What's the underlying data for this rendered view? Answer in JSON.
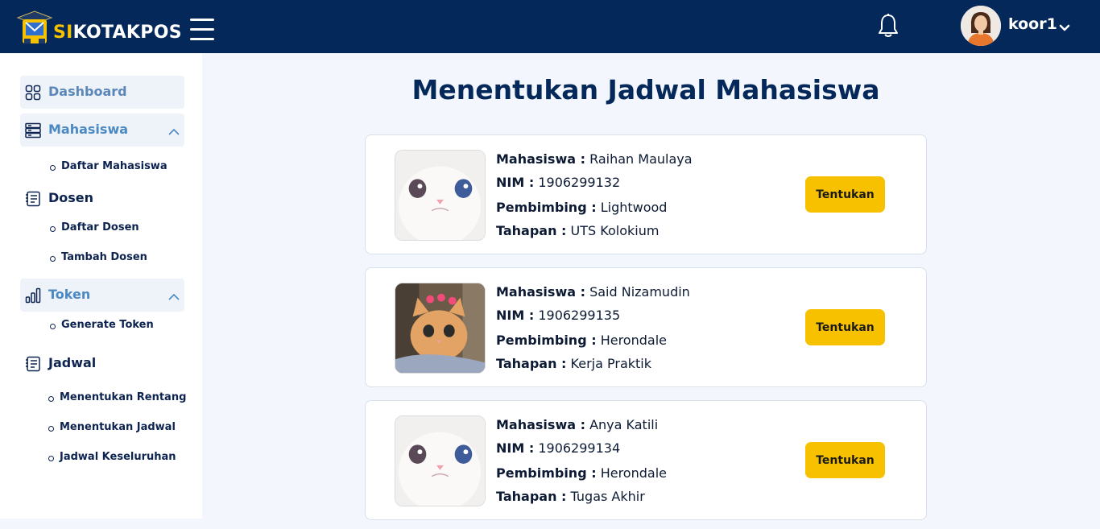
{
  "header": {
    "brand_prefix": "SI",
    "brand_suffix": "KOTAKPOS",
    "username": "koor1"
  },
  "sidebar": {
    "dashboard": "Dashboard",
    "mahasiswa": "Mahasiswa",
    "daftar_mahasiswa": "Daftar Mahasiswa",
    "dosen": "Dosen",
    "daftar_dosen": "Daftar Dosen",
    "tambah_dosen": "Tambah Dosen",
    "token": "Token",
    "generate_token": "Generate Token",
    "jadwal": "Jadwal",
    "menentukan_rentang": "Menentukan Rentang",
    "menentukan_jadwal": "Menentukan Jadwal",
    "jadwal_keseluruhan": "Jadwal Keseluruhan"
  },
  "main": {
    "title": "Menentukan Jadwal Mahasiswa",
    "labels": {
      "mahasiswa": "Mahasiswa :",
      "nim": "NIM :",
      "pembimbing": "Pembimbing :",
      "tahapan": "Tahapan :"
    },
    "button_label": "Tentukan",
    "students": [
      {
        "name": "Raihan Maulaya",
        "nim": "1906299132",
        "pembimbing": "Lightwood",
        "tahapan": "UTS Kolokium",
        "photo": "white-cat-photo"
      },
      {
        "name": "Said Nizamudin",
        "nim": "1906299135",
        "pembimbing": "Herondale",
        "tahapan": "Kerja Praktik",
        "photo": "orange-cat-hearts-photo"
      },
      {
        "name": "Anya Katili",
        "nim": "1906299134",
        "pembimbing": "Herondale",
        "tahapan": "Tugas Akhir",
        "photo": "white-cat-photo"
      }
    ]
  },
  "colors": {
    "navbar": "#042859",
    "accent_yellow": "#f7c100",
    "active_nav_text": "#4a89c2",
    "background": "#f3f7fd"
  }
}
